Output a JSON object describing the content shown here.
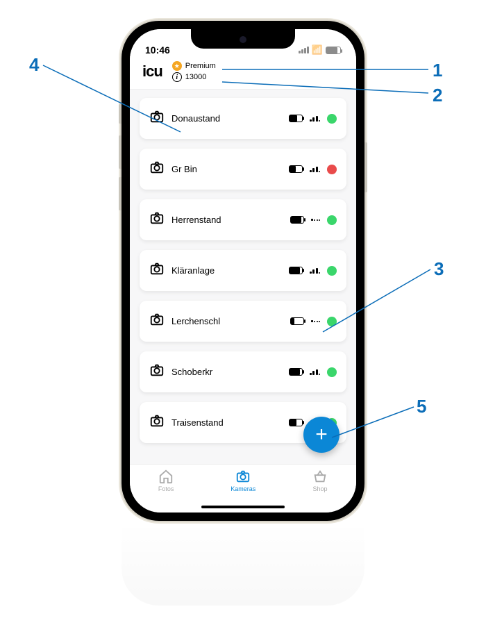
{
  "status": {
    "time": "10:46"
  },
  "header": {
    "logo": "icu",
    "premium_label": "Premium",
    "points_value": "13000"
  },
  "cameras": [
    {
      "name": "Donaustand",
      "battery": 0.65,
      "signal": [
        1,
        1,
        1,
        0
      ],
      "status": "green"
    },
    {
      "name": "Gr Bin",
      "battery": 0.55,
      "signal": [
        1,
        1,
        1,
        0
      ],
      "status": "red"
    },
    {
      "name": "Herrenstand",
      "battery": 0.85,
      "signal": [
        1,
        0,
        0,
        0
      ],
      "status": "green"
    },
    {
      "name": "Kläranlage",
      "battery": 0.85,
      "signal": [
        1,
        1,
        1,
        0
      ],
      "status": "green"
    },
    {
      "name": "Lerchenschl",
      "battery": 0.3,
      "signal": [
        1,
        0,
        0,
        0
      ],
      "status": "green"
    },
    {
      "name": "Schoberkr",
      "battery": 0.85,
      "signal": [
        1,
        1,
        1,
        0
      ],
      "status": "green"
    },
    {
      "name": "Traisenstand",
      "battery": 0.6,
      "signal": [
        1,
        1,
        1,
        0
      ],
      "status": "green"
    }
  ],
  "tabs": {
    "fotos": "Fotos",
    "kameras": "Kameras",
    "shop": "Shop"
  },
  "callouts": {
    "c1": "1",
    "c2": "2",
    "c3": "3",
    "c4": "4",
    "c5": "5"
  },
  "colors": {
    "accent": "#0b87d6",
    "ok": "#3ad66b",
    "bad": "#e94b4b",
    "callout": "#0b6db8"
  }
}
